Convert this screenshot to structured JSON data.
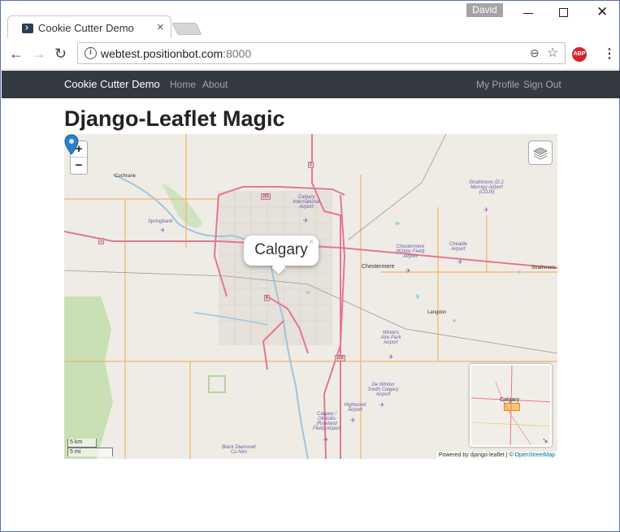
{
  "browser": {
    "tab_title": "Cookie Cutter Demo",
    "user_name": "David",
    "url_host": "webtest.positionbot.com",
    "url_port": ":8000",
    "abp_label": "ABP"
  },
  "app": {
    "brand": "Cookie Cutter Demo",
    "nav_left": [
      "Home",
      "About"
    ],
    "nav_right": [
      "My Profile",
      "Sign Out"
    ]
  },
  "page": {
    "title": "Django-Leaflet Magic"
  },
  "map": {
    "zoom_in": "+",
    "zoom_out": "−",
    "popup_text": "Calgary",
    "popup_close": "×",
    "minimap_label": "Calgary",
    "scale_km": "5 km",
    "scale_mi": "5 mi",
    "attribution_prefix": "Powered by django-leaflet | © ",
    "attribution_link": "OpenStreetMap",
    "places": [
      "Cochrane",
      "Springbank",
      "Chestermere",
      "Langdon",
      "Strathmore",
      "Black Diamond/ Cu Nim"
    ],
    "airports": [
      "Calgary International Airport",
      "Chestermere (Kirkby Field) Airport",
      "Strathmore (D.J. Murray) Airport (CDJ5)",
      "Cheadle Airport",
      "Winters Aire Park Airport",
      "De Winton South Calgary Airport",
      "Highwood Airport",
      "Calgary / Okotoks (Rowland Field) Airport"
    ],
    "route_shields": [
      "1",
      "2",
      "201",
      "8",
      "22X"
    ],
    "accent_marker": "#2a81cb"
  }
}
